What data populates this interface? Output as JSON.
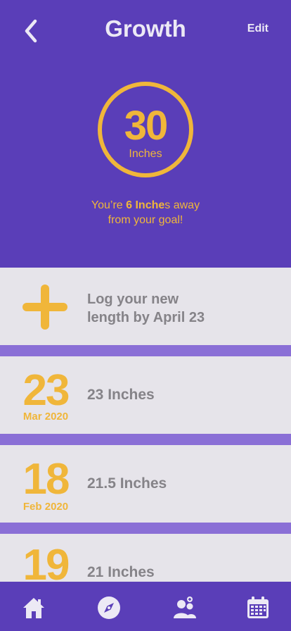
{
  "header": {
    "title": "Growth",
    "edit_label": "Edit",
    "back_icon": "chevron-left-icon"
  },
  "progress": {
    "value": "30",
    "unit": "Inches",
    "goal_prefix": "You’re ",
    "goal_amount": "6 Inche",
    "goal_suffix": "s away",
    "goal_line2": "from your goal!"
  },
  "log_card": {
    "icon": "plus-icon",
    "line1": "Log your new",
    "line2": "length by April 23"
  },
  "entries": [
    {
      "day": "23",
      "date": "Mar 2020",
      "value": "23 Inches"
    },
    {
      "day": "18",
      "date": "Feb 2020",
      "value": "21.5 Inches"
    },
    {
      "day": "19",
      "date": "",
      "value": "21 Inches"
    }
  ],
  "tabbar": {
    "items": [
      "home-icon",
      "compass-icon",
      "people-icon",
      "calendar-icon"
    ]
  },
  "colors": {
    "primary": "#5a3eb8",
    "accent": "#f0b63a",
    "card": "#e6e4ea",
    "text_gray": "#858388"
  }
}
